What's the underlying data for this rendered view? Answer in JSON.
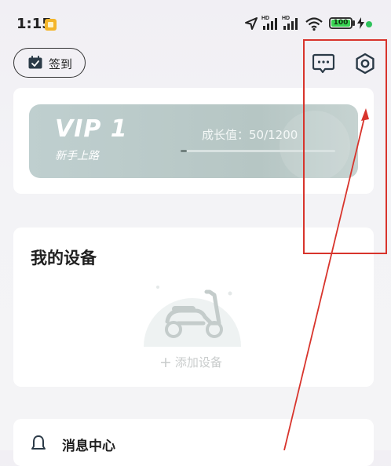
{
  "status_bar": {
    "time": "1:15",
    "battery": "100"
  },
  "header": {
    "checkin_label": "签到",
    "icons": [
      "calendar-check-icon",
      "message-icon",
      "settings-icon"
    ]
  },
  "vip_card": {
    "level": "VIP 1",
    "subtitle": "新手上路",
    "growth_text": "成长值：50/1200",
    "growth_current": 50,
    "growth_max": 1200
  },
  "device_card": {
    "title": "我的设备",
    "add_label": "添加设备"
  },
  "message_card": {
    "label": "消息中心"
  },
  "annotation": {
    "color": "#d8342c"
  },
  "colors": {
    "accent_vip": "#b6c6c4",
    "background": "#f3f3f6"
  }
}
